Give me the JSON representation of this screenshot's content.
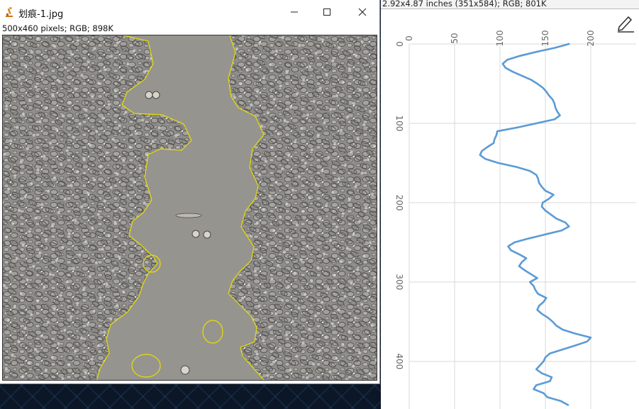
{
  "window": {
    "title": "划痕-1.jpg",
    "image_info": "500x460 pixels; RGB; 898K",
    "controls": {
      "minimize": "minimize-icon",
      "maximize": "maximize-icon",
      "close": "close-icon"
    }
  },
  "panel": {
    "header_text": "2.92x4.87 inches (351x584); RGB; 801K",
    "tool_icon": "pen-edit-icon"
  },
  "colors": {
    "trace": "#5b9bd5",
    "outline": "#e8e000",
    "grid": "#d9d9d9"
  },
  "chart_data": {
    "type": "line",
    "orientation": "vertical-profile",
    "x_ticks": [
      "0",
      "50",
      "100",
      "150",
      "200"
    ],
    "y_ticks": [
      "0",
      "100",
      "200",
      "300",
      "400"
    ],
    "xlim": [
      0,
      250
    ],
    "ylim": [
      0,
      460
    ],
    "grid": true,
    "series": [
      {
        "values_y": [
          0,
          5,
          10,
          15,
          20,
          25,
          30,
          35,
          40,
          45,
          50,
          55,
          60,
          65,
          70,
          75,
          80,
          85,
          90,
          95,
          100,
          105,
          110,
          115,
          120,
          125,
          130,
          135,
          140,
          145,
          150,
          155,
          160,
          165,
          170,
          175,
          180,
          185,
          190,
          195,
          200,
          205,
          210,
          215,
          220,
          225,
          230,
          235,
          240,
          245,
          250,
          255,
          260,
          265,
          270,
          275,
          280,
          285,
          290,
          295,
          300,
          305,
          310,
          315,
          320,
          325,
          330,
          335,
          340,
          345,
          350,
          355,
          360,
          365,
          370,
          375,
          380,
          385,
          390,
          395,
          400,
          405,
          410,
          415,
          420,
          425,
          430,
          435,
          440,
          445,
          450,
          455
        ],
        "values_x": [
          176,
          160,
          140,
          122,
          108,
          103,
          106,
          114,
          124,
          134,
          141,
          147,
          151,
          154,
          158,
          160,
          161,
          163,
          166,
          160,
          140,
          120,
          97,
          96,
          94,
          93,
          86,
          80,
          78,
          84,
          98,
          118,
          133,
          140,
          142,
          143,
          146,
          150,
          159,
          154,
          147,
          146,
          150,
          156,
          162,
          172,
          176,
          168,
          150,
          132,
          116,
          109,
          112,
          121,
          129,
          124,
          121,
          127,
          134,
          141,
          133,
          137,
          139,
          142,
          151,
          148,
          143,
          141,
          146,
          153,
          158,
          162,
          169,
          183,
          200,
          196,
          183,
          169,
          155,
          150,
          148,
          144,
          140,
          146,
          157,
          155,
          140,
          137,
          148,
          152,
          167,
          175
        ]
      }
    ]
  }
}
